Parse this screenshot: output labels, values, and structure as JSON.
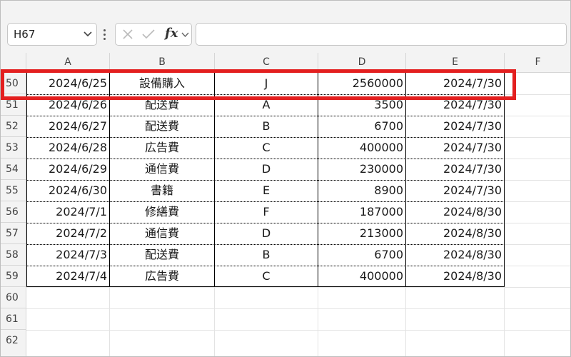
{
  "name_box": {
    "value": "H67"
  },
  "formula_bar": {
    "fx_label": "fx",
    "value": ""
  },
  "columns": [
    "A",
    "B",
    "C",
    "D",
    "E",
    "F"
  ],
  "rows": [
    {
      "num": "50",
      "a": "2024/6/25",
      "b": "設備購入",
      "c": "J",
      "d": "2560000",
      "e": "2024/7/30"
    },
    {
      "num": "51",
      "a": "2024/6/26",
      "b": "配送費",
      "c": "A",
      "d": "3500",
      "e": "2024/7/30"
    },
    {
      "num": "52",
      "a": "2024/6/27",
      "b": "配送費",
      "c": "B",
      "d": "6700",
      "e": "2024/7/30"
    },
    {
      "num": "53",
      "a": "2024/6/28",
      "b": "広告費",
      "c": "C",
      "d": "400000",
      "e": "2024/7/30"
    },
    {
      "num": "54",
      "a": "2024/6/29",
      "b": "通信費",
      "c": "D",
      "d": "230000",
      "e": "2024/7/30"
    },
    {
      "num": "55",
      "a": "2024/6/30",
      "b": "書籍",
      "c": "E",
      "d": "8900",
      "e": "2024/7/30"
    },
    {
      "num": "56",
      "a": "2024/7/1",
      "b": "修繕費",
      "c": "F",
      "d": "187000",
      "e": "2024/8/30"
    },
    {
      "num": "57",
      "a": "2024/7/2",
      "b": "通信費",
      "c": "D",
      "d": "213000",
      "e": "2024/8/30"
    },
    {
      "num": "58",
      "a": "2024/7/3",
      "b": "配送費",
      "c": "B",
      "d": "6700",
      "e": "2024/8/30"
    },
    {
      "num": "59",
      "a": "2024/7/4",
      "b": "広告費",
      "c": "C",
      "d": "400000",
      "e": "2024/8/30"
    }
  ],
  "empty_rows": [
    "60",
    "61",
    "62"
  ],
  "colors": {
    "highlight": "#e31f1f",
    "header_bg": "#f3f3f3",
    "grid": "#e3e3e3"
  }
}
